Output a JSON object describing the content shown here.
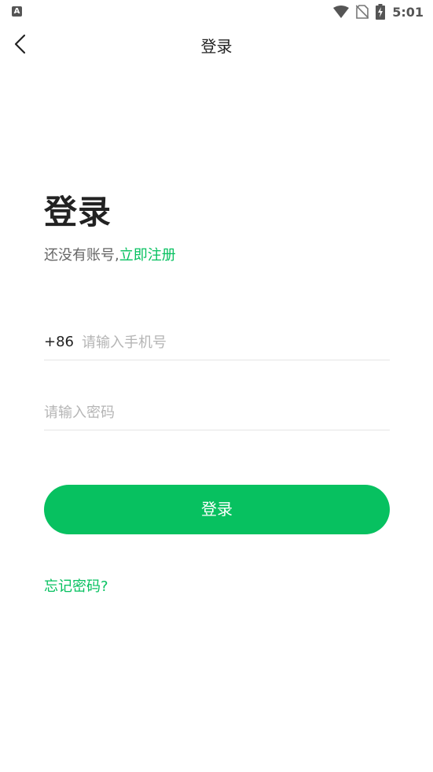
{
  "status_bar": {
    "notification_icon": "A",
    "time": "5:01",
    "icons": [
      "wifi-icon",
      "no-sim-icon",
      "battery-charging-icon"
    ]
  },
  "nav": {
    "back_icon": "chevron-left-icon",
    "title": "登录"
  },
  "main": {
    "heading": "登录",
    "no_account_text": "还没有账号,",
    "register_link": "立即注册",
    "phone": {
      "country_code": "+86",
      "placeholder": "请输入手机号",
      "value": ""
    },
    "password": {
      "placeholder": "请输入密码",
      "value": ""
    },
    "login_button": "登录",
    "forgot_password": "忘记密码?"
  },
  "colors": {
    "accent": "#07c160",
    "text": "#222222",
    "placeholder": "#b5b5b5",
    "divider": "#e5e5e5"
  }
}
